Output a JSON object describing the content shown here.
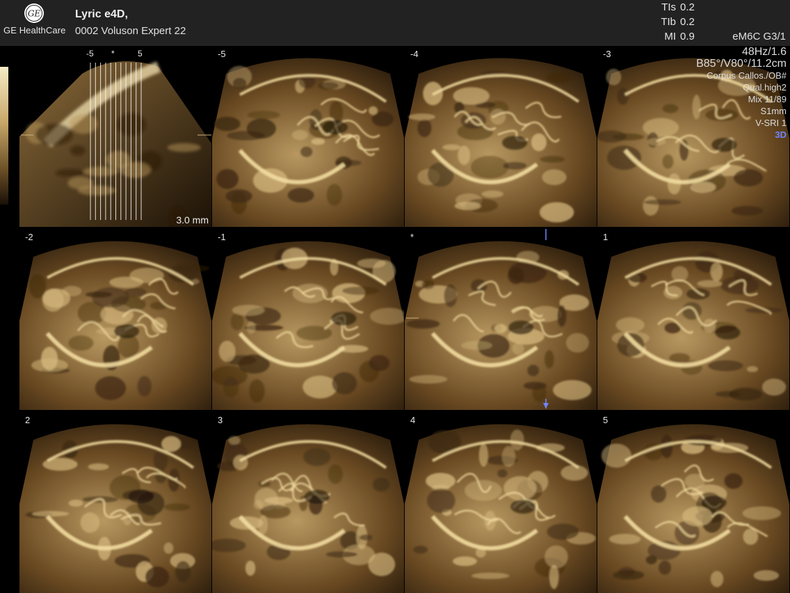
{
  "header": {
    "brand": "GE HealthCare",
    "logo_text": "GE",
    "patient_line": "Lyric e4D,",
    "device_line": "0002 Voluson Expert 22",
    "indices": [
      {
        "label": "TIs",
        "value": "0.2"
      },
      {
        "label": "TIb",
        "value": "0.2"
      },
      {
        "label": "MI",
        "value": "0.9"
      }
    ],
    "probe": "eM6C G3/1"
  },
  "params": {
    "frame_rate": "48Hz/1.6",
    "geometry": "B85°/V80°/11.2cm",
    "preset": "Corpus Callos./OB#",
    "quality": "Qual.high2",
    "mix": "Mix 11/89",
    "slice_thickness": "S1mm",
    "render": "V-SRI 1",
    "mode": "3D"
  },
  "colors": {
    "accent_blue": "#6f86ff",
    "sepia_bright": "#f2dca0",
    "sepia_dark": "#1c1206",
    "header_bg": "#222222"
  },
  "reference_tile": {
    "marks": [
      "-5",
      "*",
      "5"
    ],
    "slice_spacing": "3.0 mm"
  },
  "slices": [
    {
      "label": "-5"
    },
    {
      "label": "-4"
    },
    {
      "label": "-3"
    },
    {
      "label": "-2"
    },
    {
      "label": "-1"
    },
    {
      "label": "*"
    },
    {
      "label": "1"
    },
    {
      "label": "2"
    },
    {
      "label": "3"
    },
    {
      "label": "4"
    },
    {
      "label": "5"
    }
  ]
}
